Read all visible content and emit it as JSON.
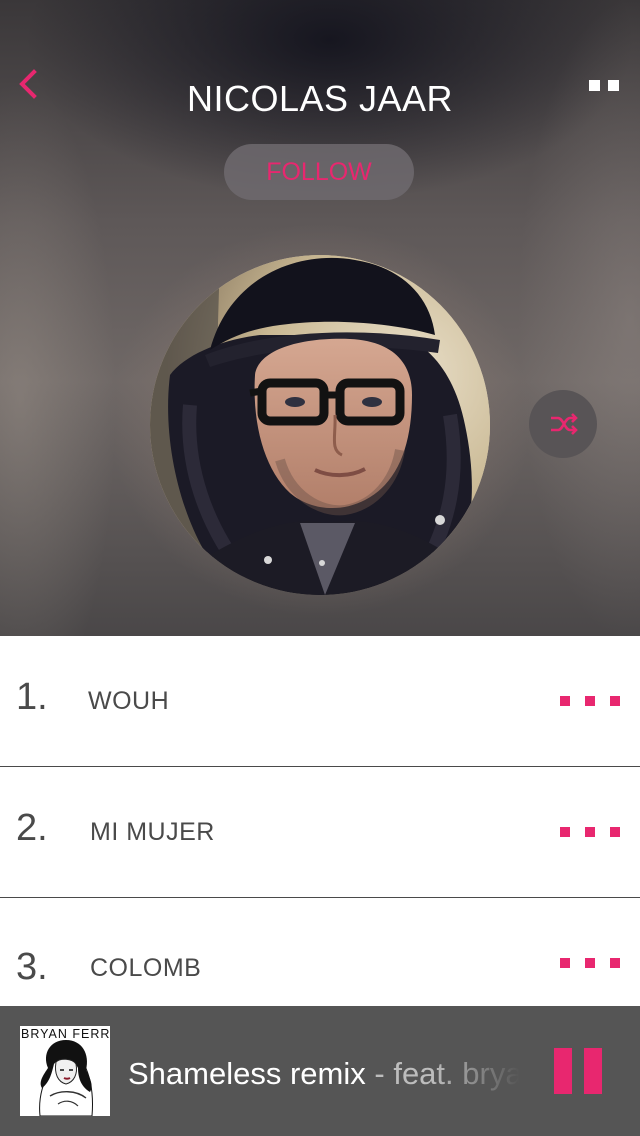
{
  "header": {
    "artist_name": "NICOLAS JAAR",
    "follow_label": "FOLLOW"
  },
  "tracks": [
    {
      "number": "1.",
      "title": "WOUH"
    },
    {
      "number": "2.",
      "title": "MI MUJER"
    },
    {
      "number": "3.",
      "title": "COLOMB"
    }
  ],
  "player": {
    "album_label": "BRYAN FERRY",
    "track_title": "Shameless remix",
    "separator": "-",
    "featuring": "feat. bryan ferry"
  },
  "icons": {
    "back": "chevron-left-icon",
    "menu": "two-dots-menu-icon",
    "shuffle": "shuffle-icon",
    "track_more": "three-dots-more-icon",
    "pause": "pause-icon"
  },
  "colors": {
    "accent": "#e8276f",
    "player_bar": "#555555",
    "text_dark": "#4a4a4a"
  }
}
